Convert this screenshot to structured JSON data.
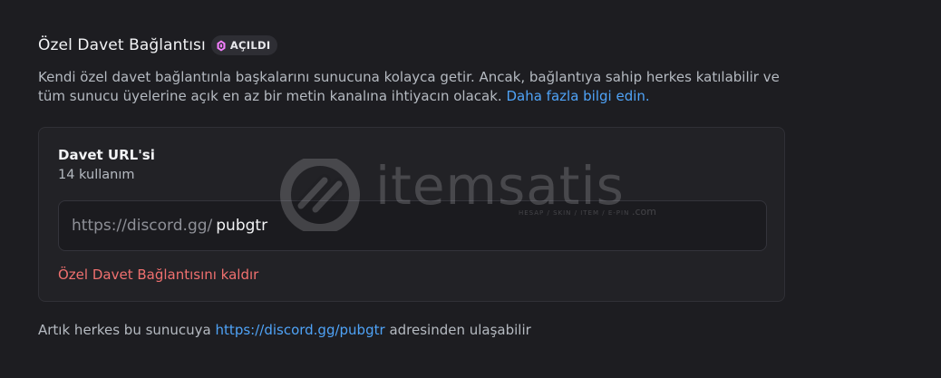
{
  "header": {
    "title": "Özel Davet Bağlantısı",
    "badge_label": "AÇILDI",
    "badge_icon": "boost-gem-icon",
    "badge_color": "#f47fff"
  },
  "description": {
    "text": "Kendi özel davet bağlantınla başkalarını sunucuna kolayca getir. Ancak, bağlantıya sahip herkes katılabilir ve tüm sunucu üyelerine açık en az bir metin kanalına ihtiyacın olacak.",
    "learn_more": "Daha fazla bilgi edin."
  },
  "invite_card": {
    "title": "Davet URL'si",
    "uses": "14 kullanım",
    "url_prefix": "https://discord.gg/",
    "url_code": "pubgtr",
    "remove_label": "Özel Davet Bağlantısını kaldır"
  },
  "footer": {
    "before": "Artık herkes bu sunucuya",
    "link": "https://discord.gg/pubgtr",
    "after": "adresinden ulaşabilir"
  },
  "watermark": {
    "text": "itemsatis",
    "sub": "HESAP / SKIN / ITEM / E-PIN",
    "suffix": ".com"
  },
  "colors": {
    "background": "#1d1d21",
    "link": "#4fa3f7",
    "danger": "#f0706f"
  }
}
